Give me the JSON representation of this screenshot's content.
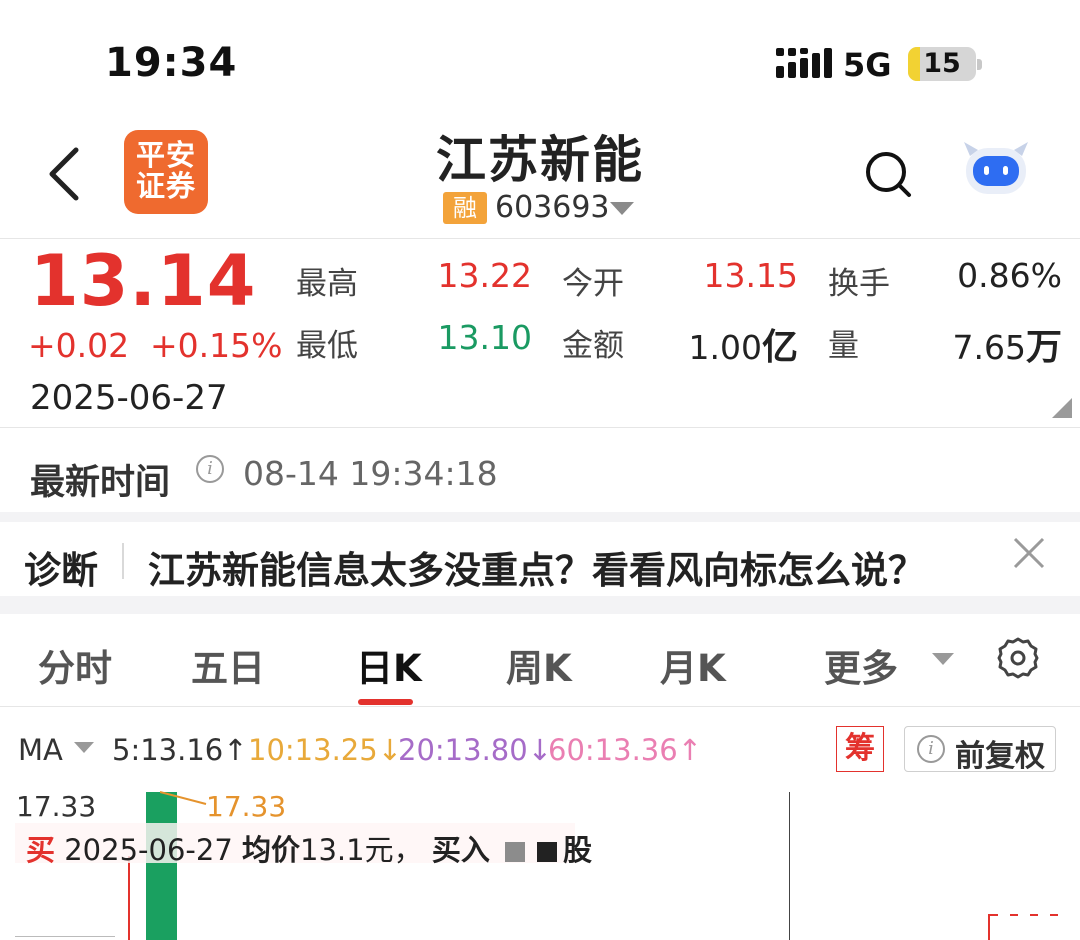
{
  "status_bar": {
    "time": "19:34",
    "network": "5G",
    "battery": "15"
  },
  "header": {
    "logo_line1": "平安",
    "logo_line2": "证券",
    "stock_name": "江苏新能",
    "margin_badge": "融",
    "stock_code": "603693",
    "icons": [
      "back-icon",
      "search-icon",
      "robot-assistant-icon"
    ]
  },
  "quote": {
    "price": "13.14",
    "change": "+0.02",
    "change_pct": "+0.15%",
    "date": "2025-06-27",
    "high_label": "最高",
    "high": "13.22",
    "open_label": "今开",
    "open": "13.15",
    "turnover_label": "换手",
    "turnover": "0.86%",
    "low_label": "最低",
    "low": "13.10",
    "amount_label": "金额",
    "amount": "1.00",
    "amount_unit": "亿",
    "volume_label": "量",
    "volume": "7.65",
    "volume_unit": "万"
  },
  "latest_time": {
    "label": "最新时间",
    "value": "08-14 19:34:18"
  },
  "diagnosis": {
    "title": "诊断",
    "text": "江苏新能信息太多没重点？看看风向标怎么说？"
  },
  "tabs": [
    "分时",
    "五日",
    "日K",
    "周K",
    "月K",
    "更多"
  ],
  "active_tab": "日K",
  "ma": {
    "label": "MA",
    "ma5": "5:13.16↑",
    "ma10": "10:13.25↓",
    "ma20": "20:13.80↓",
    "ma60": "60:13.36↑",
    "colors": {
      "ma5": "#333333",
      "ma10": "#e8a93a",
      "ma20": "#a66cc8",
      "ma60": "#ea7fb2"
    },
    "chip_button": "筹",
    "adjust_button": "前复权"
  },
  "chart": {
    "high_value": "17.33",
    "peak_label": "17.33",
    "trade_tip": {
      "buy": "买",
      "date": "2025-06-27",
      "avg_label": "均价",
      "avg_value": "13.1元，",
      "action": "买入",
      "suffix": "股"
    }
  }
}
